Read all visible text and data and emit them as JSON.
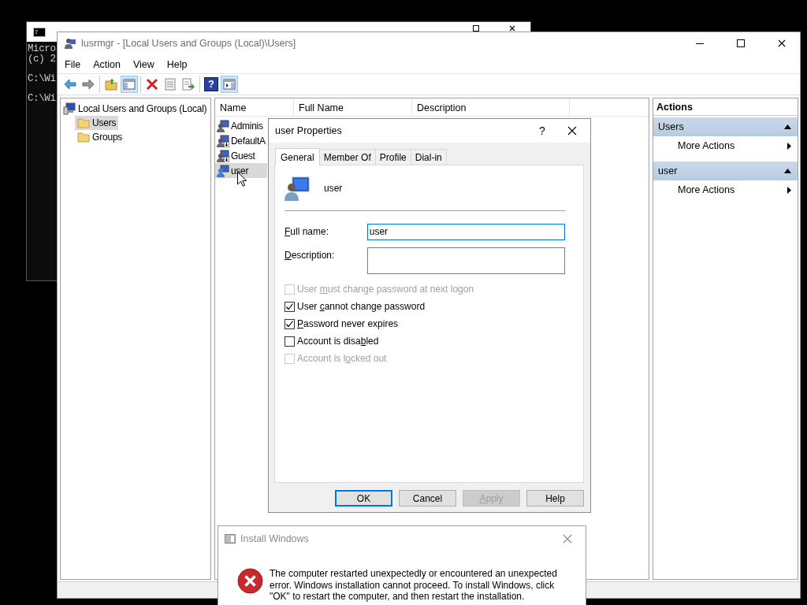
{
  "console_window": {
    "paragraphs": [
      {
        "lines": [
          "Micro",
          "(c) 2"
        ]
      },
      {
        "lines": [
          "C:\\Wi"
        ]
      },
      {
        "lines": [
          "C:\\Wi"
        ]
      }
    ]
  },
  "main_window": {
    "title": "lusrmgr - [Local Users and Groups (Local)\\Users]",
    "menu": [
      "File",
      "Action",
      "View",
      "Help"
    ],
    "toolbar": [
      {
        "buttons": [
          {
            "kind": "back",
            "pressed": false
          },
          {
            "kind": "forward",
            "pressed": false
          }
        ]
      },
      {
        "buttons": [
          {
            "kind": "up",
            "pressed": false
          },
          {
            "kind": "tree",
            "pressed": true
          }
        ]
      },
      {
        "buttons": [
          {
            "kind": "delete",
            "pressed": false
          },
          {
            "kind": "properties",
            "pressed": false
          },
          {
            "kind": "export",
            "pressed": false
          }
        ]
      },
      {
        "buttons": [
          {
            "kind": "help",
            "pressed": false,
            "glyph": "?"
          },
          {
            "kind": "action_pane",
            "pressed": true
          }
        ]
      }
    ],
    "tree": [
      {
        "label": "Local Users and Groups (Local)",
        "kind": "computer",
        "selected": false,
        "children": [
          {
            "label": "Users",
            "kind": "folder",
            "selected": true
          },
          {
            "label": "Groups",
            "kind": "folder",
            "selected": false
          }
        ]
      }
    ],
    "list": {
      "columns": [
        "Name",
        "Full Name",
        "Description"
      ],
      "rows": [
        {
          "name": "Adminis",
          "kind": "admin",
          "selected": false
        },
        {
          "name": "DefaultA",
          "kind": "disabled_user",
          "selected": false
        },
        {
          "name": "Guest",
          "kind": "disabled_user",
          "selected": false
        },
        {
          "name": "user",
          "kind": "user",
          "selected": true
        }
      ]
    },
    "actions": {
      "title": "Actions",
      "sections": [
        {
          "title": "Users",
          "expanded": true,
          "items": [
            "More Actions"
          ]
        },
        {
          "title": "user",
          "expanded": true,
          "items": [
            "More Actions"
          ]
        }
      ]
    }
  },
  "properties_dialog": {
    "title": "user Properties",
    "help_glyph": "?",
    "tabs": [
      {
        "label": "General",
        "selected": true
      },
      {
        "label": "Member Of",
        "selected": false
      },
      {
        "label": "Profile",
        "selected": false
      },
      {
        "label": "Dial-in",
        "selected": false
      }
    ],
    "user_name": "user",
    "fields": [
      {
        "label": {
          "key": "F",
          "post": "ull name:"
        },
        "value": "user",
        "focused": true,
        "kind": "line"
      },
      {
        "label": {
          "key": "D",
          "post": "escription:"
        },
        "focused": false,
        "kind": "box"
      }
    ],
    "checkboxes": [
      {
        "label": {
          "pre": "User ",
          "key": "m",
          "post": "ust change password at next logon"
        },
        "checked": false,
        "disabled": true
      },
      {
        "label": {
          "pre": "User ",
          "key": "c",
          "post": "annot change password"
        },
        "checked": true,
        "disabled": false
      },
      {
        "label": {
          "key": "P",
          "post": "assword never expires"
        },
        "checked": true,
        "disabled": false
      },
      {
        "label": {
          "pre": "Account is disa",
          "key": "b",
          "post": "led"
        },
        "checked": false,
        "disabled": false
      },
      {
        "label": {
          "pre": "Account is l",
          "key": "o",
          "post": "cked out"
        },
        "checked": false,
        "disabled": true
      }
    ],
    "buttons": [
      {
        "label": {
          "pre": "OK"
        },
        "default": true,
        "disabled": false
      },
      {
        "label": {
          "pre": "Cancel"
        },
        "default": false,
        "disabled": false
      },
      {
        "label": {
          "key": "A",
          "post": "pply"
        },
        "default": false,
        "disabled": true
      },
      {
        "label": {
          "pre": "Help"
        },
        "default": false,
        "disabled": false
      }
    ]
  },
  "error_dialog": {
    "title": "Install Windows",
    "message": "The computer restarted unexpectedly or encountered an unexpected error. Windows installation cannot proceed. To install Windows, click \"OK\" to restart the computer, and then restart the installation."
  }
}
